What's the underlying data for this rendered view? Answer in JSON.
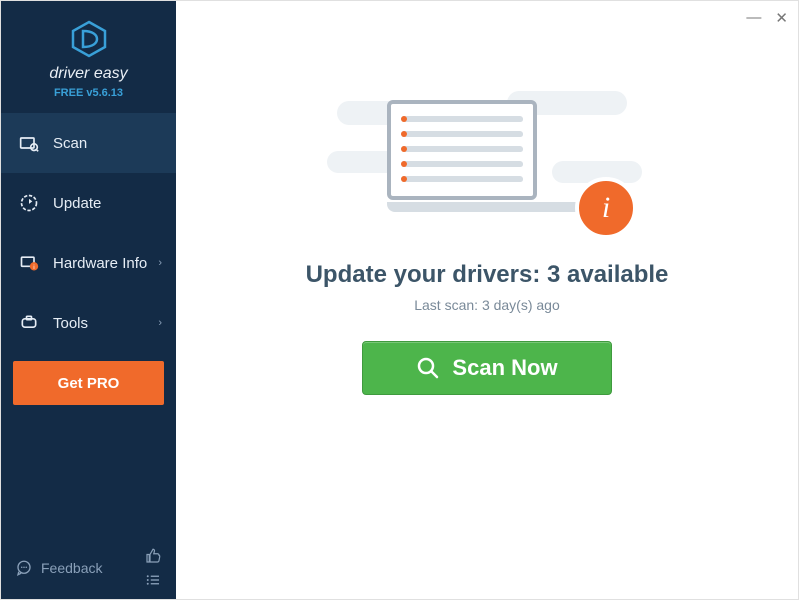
{
  "app": {
    "name": "driver easy",
    "version": "FREE v5.6.13"
  },
  "sidebar": {
    "items": [
      {
        "label": "Scan"
      },
      {
        "label": "Update"
      },
      {
        "label": "Hardware Info"
      },
      {
        "label": "Tools"
      }
    ],
    "get_pro": "Get PRO",
    "feedback": "Feedback"
  },
  "main": {
    "headline": "Update your drivers: 3 available",
    "subline": "Last scan: 3 day(s) ago",
    "scan_button": "Scan Now"
  }
}
